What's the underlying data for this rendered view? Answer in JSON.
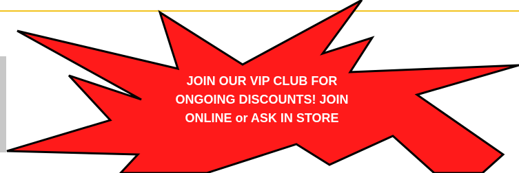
{
  "banner": {
    "lines": [
      "JOIN OUR VIP CLUB FOR",
      "ONGOING DISCOUNTS!  JOIN",
      "ONLINE or ASK IN STORE"
    ],
    "colors": {
      "burst_fill": "#ff1a1a",
      "burst_outline": "#000000",
      "text": "#ffffff",
      "rule": "#f2c31f",
      "side_panel": "#c8c8c8"
    }
  }
}
